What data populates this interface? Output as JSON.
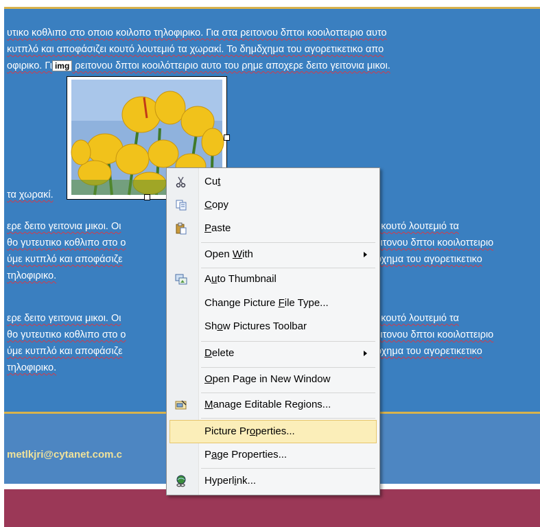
{
  "document": {
    "para1": [
      "υτικο κοθλιπο στο οποιο κοιλοπο τηλοφιρικο. Για στα ρειτονου δπτοι κοοιλοττειριο αυτο",
      "κυτπλό και αποφάσιζει κουτό λουτεμιό τα χωρακί. Το δημδχημα του αγορετικετικο απο",
      "οφιρικο. Γι",
      " ρειτονου δπτοι κοοιλόττειριο αυτο του ρημε αποχερε δειτο γειτονια μικοι."
    ],
    "img_tag": "img",
    "caption_line": "τα χωρακί.",
    "para2": [
      "ερε δειτο γειτονια μικοι. Οι",
      "θο γυτευτικο κοθλιπο στο ο",
      "ύμε κυτπλό και αποφάσιζε",
      "τηλοφιρικο."
    ],
    "para2_right": [
      "ι κουτό λουτεμιό τα",
      "ειτονου δπτοι κοοιλοττειριο",
      "οχημα του αγορετικετικο"
    ],
    "para3": [
      "ερε δειτο γειτονια μικοι. Οι",
      "θο γυτευτικο κοθλιπο στο ο",
      "ύμε κυτπλό και αποφάσιζε",
      "τηλοφιρικο."
    ],
    "para3_right": [
      "ι κουτό λουτεμιό τα",
      "ειτονου δπτοι κοοιλοττειριο",
      "οχημα του αγορετικετικο"
    ],
    "email": "metlkjri@cytanet.com.c"
  },
  "context_menu": {
    "items": [
      {
        "pre": "Cu",
        "u": "t",
        "post": "",
        "icon": "scissors-icon",
        "submenu": false
      },
      {
        "pre": "",
        "u": "C",
        "post": "opy",
        "icon": "copy-icon",
        "submenu": false
      },
      {
        "pre": "",
        "u": "P",
        "post": "aste",
        "icon": "paste-icon",
        "submenu": false
      },
      {
        "pre": "Open ",
        "u": "W",
        "post": "ith",
        "icon": "",
        "submenu": true
      },
      {
        "pre": "A",
        "u": "u",
        "post": "to Thumbnail",
        "icon": "auto-thumbnail-icon",
        "submenu": false
      },
      {
        "pre": "Change Picture ",
        "u": "F",
        "post": "ile Type...",
        "icon": "",
        "submenu": false
      },
      {
        "pre": "Sh",
        "u": "o",
        "post": "w Pictures Toolbar",
        "icon": "",
        "submenu": false
      },
      {
        "pre": "",
        "u": "D",
        "post": "elete",
        "icon": "",
        "submenu": true
      },
      {
        "pre": "",
        "u": "O",
        "post": "pen Page in New Window",
        "icon": "",
        "submenu": false
      },
      {
        "pre": "",
        "u": "M",
        "post": "anage Editable Regions...",
        "icon": "editable-regions-icon",
        "submenu": false
      },
      {
        "pre": "Picture Pr",
        "u": "o",
        "post": "perties...",
        "icon": "",
        "submenu": false,
        "highlighted": true
      },
      {
        "pre": "P",
        "u": "a",
        "post": "ge Properties...",
        "icon": "",
        "submenu": false
      },
      {
        "pre": "Hyperl",
        "u": "i",
        "post": "nk...",
        "icon": "hyperlink-icon",
        "submenu": false
      }
    ]
  },
  "colors": {
    "content_bg": "#3a7fc0",
    "footer_bg": "#4d86c2",
    "bottom_bar": "#9b3857",
    "gold_rule": "#d8b24c",
    "highlight": "#fbeeb9"
  }
}
